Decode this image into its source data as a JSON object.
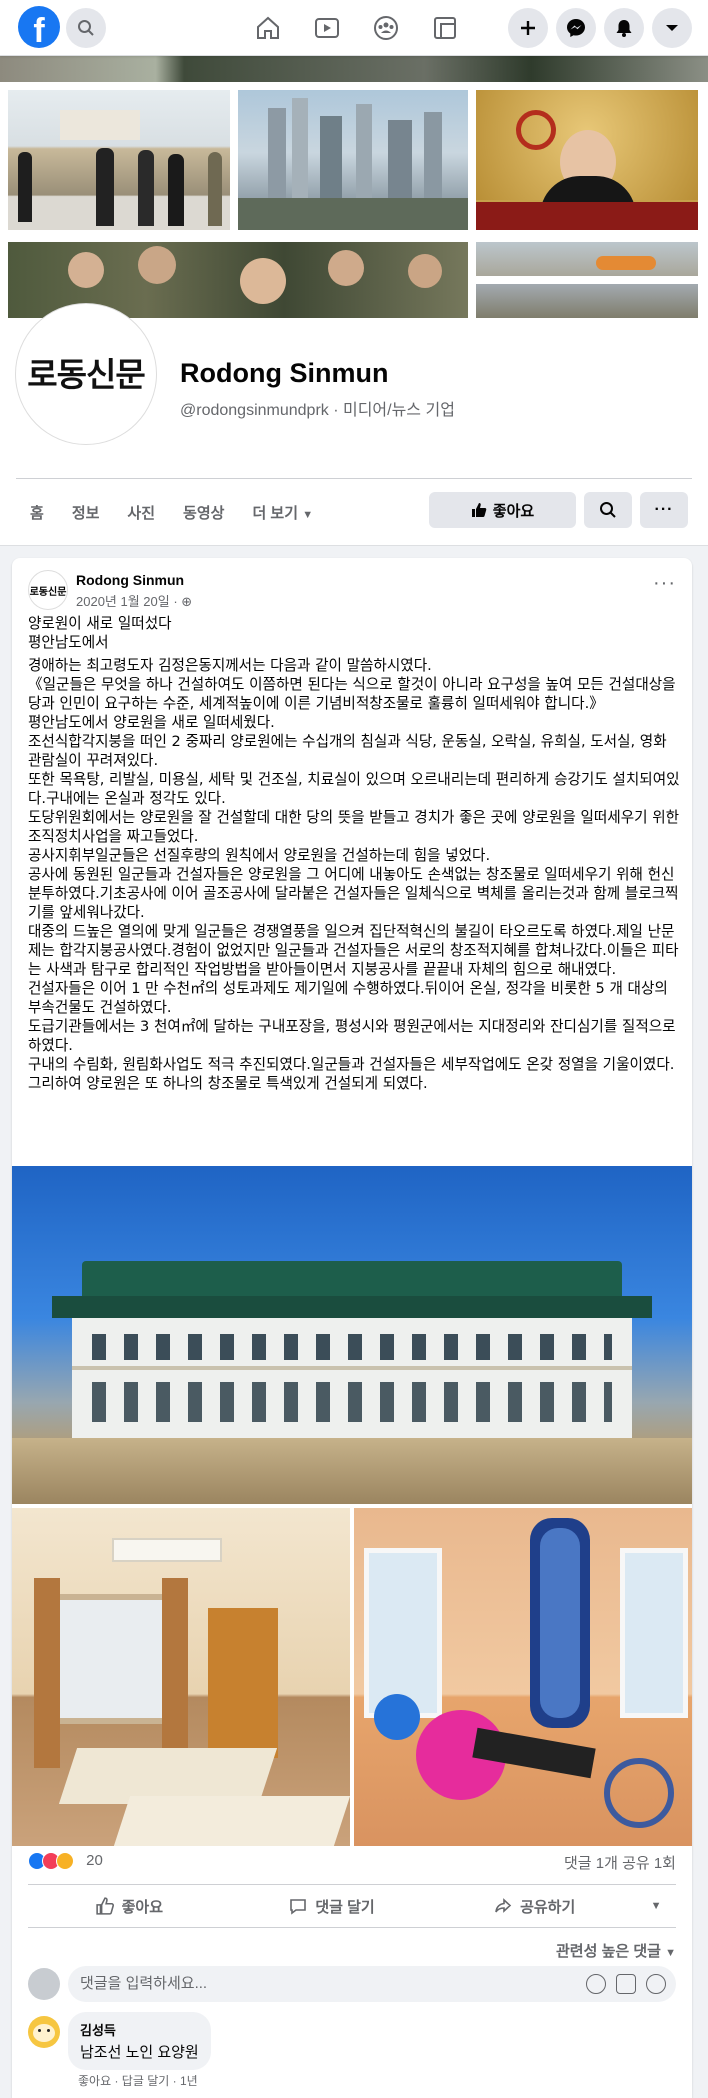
{
  "topbar": {
    "logo": "f"
  },
  "page": {
    "logo_text": "로동신문",
    "name": "Rodong Sinmun",
    "subtitle": "@rodongsinmundprk · 미디어/뉴스 기업",
    "tabs": [
      "홈",
      "정보",
      "사진",
      "동영상",
      "더 보기"
    ],
    "like_button": "좋아요"
  },
  "post": {
    "author": "Rodong Sinmun",
    "date": "2020년 1월 20일 ·",
    "paragraphs": [
      "양로원이 새로 일떠섰다",
      "평안남도에서",
      "경애하는 최고령도자 김정은동지께서는 다음과 같이 말씀하시였다.",
      "《일군들은 무엇을 하나 건설하여도 이쯤하면 된다는 식으로 할것이 아니라 요구성을 높여 모든 건설대상을 당과 인민이 요구하는 수준, 세계적높이에 이른 기념비적창조물로 훌륭히 일떠세워야 합니다.》",
      "평안남도에서 양로원을 새로 일떠세웠다.",
      "조선식합각지붕을 떠인 2 중짜리 양로원에는 수십개의 침실과 식당, 운동실, 오락실, 유희실, 도서실, 영화관람실이 꾸려져있다.",
      "또한 목욕탕, 리발실, 미용실, 세탁 및 건조실, 치료실이 있으며 오르내리는데 편리하게 승강기도 설치되여있다.구내에는 온실과 정각도 있다.",
      "도당위원회에서는 양로원을 잘 건설할데 대한 당의 뜻을 받들고 경치가 좋은 곳에 양로원을 일떠세우기 위한 조직정치사업을 짜고들었다.",
      "공사지휘부일군들은 선질후량의 원칙에서 양로원을 건설하는데 힘을 넣었다.",
      "공사에 동원된 일군들과 건설자들은 양로원을 그 어디에 내놓아도 손색없는 창조물로 일떠세우기 위해 헌신분투하였다.기초공사에 이어 골조공사에 달라붙은 건설자들은 일체식으로 벽체를 올리는것과 함께 블로크찍기를 앞세워나갔다.",
      "대중의 드높은 열의에 맞게 일군들은 경쟁열풍을 일으켜 집단적혁신의 불길이 타오르도록 하였다.제일 난문제는 합각지붕공사였다.경험이 없었지만 일군들과 건설자들은 서로의 창조적지혜를 합쳐나갔다.이들은 피타는 사색과 탐구로 합리적인 작업방법을 받아들이면서 지붕공사를 끝끝내 자체의 힘으로 해내였다.",
      "건설자들은 이어 1 만 수천㎡의 성토과제도 제기일에 수행하였다.뒤이어 온실, 정각을 비롯한 5 개 대상의 부속건물도 건설하였다.",
      "도급기관들에서는 3 천여㎡에 달하는 구내포장을, 평성시와 평원군에서는 지대정리와 잔디심기를 질적으로 하였다.",
      "구내의 수림화, 원림화사업도 적극 추진되였다.일군들과 건설자들은 세부작업에도 온갖 정열을 기울이였다.",
      "그리하여 양로원은 또 하나의 창조물로 특색있게 건설되게 되였다."
    ],
    "reaction_count": "20",
    "comment_share": "댓글 1개  공유 1회",
    "actions": [
      "좋아요",
      "댓글 달기",
      "공유하기"
    ],
    "sort_label": "관련성 높은 댓글",
    "comment_placeholder": "댓글을 입력하세요...",
    "comment": {
      "author": "김성득",
      "text": "남조선 노인 요양원",
      "meta": "좋아요 · 답글 달기 · 1년"
    }
  },
  "colors": {
    "brand": "#1877f2",
    "like": "#1877f2",
    "love": "#f33e58",
    "haha": "#f7b125"
  }
}
